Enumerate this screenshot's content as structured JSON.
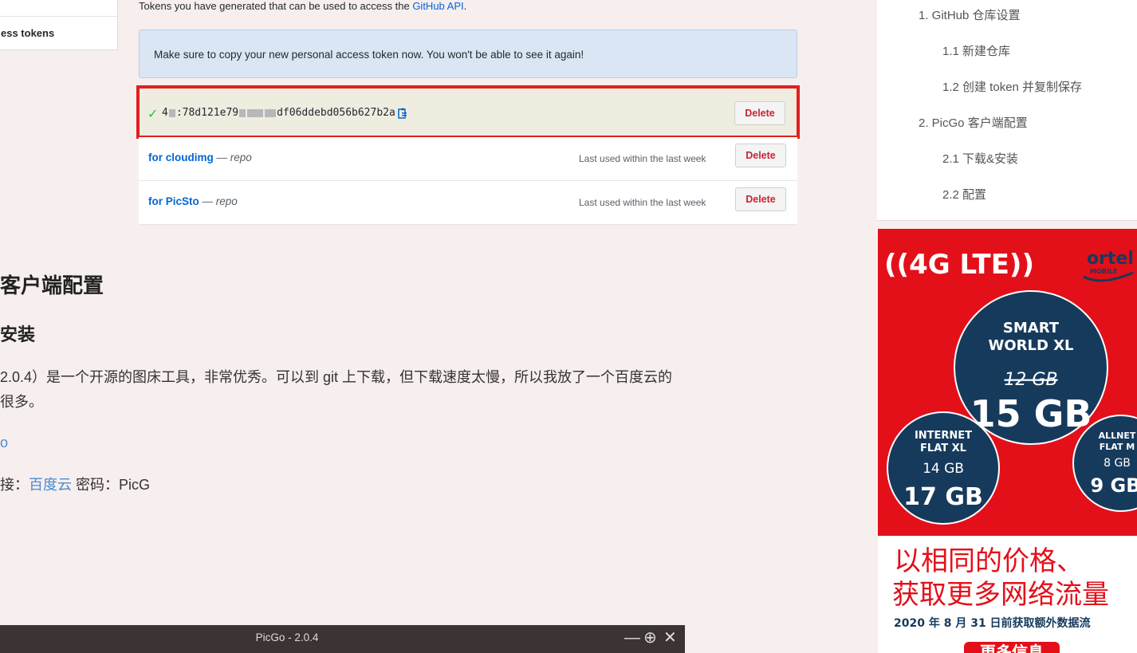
{
  "tokens_page": {
    "nav_item": "ess tokens",
    "description": "Tokens you have generated that can be used to access the",
    "description_link": "GitHub API",
    "description_end": ".",
    "flash_message": "Make sure to copy your new personal access token now. You won't be able to see it again!",
    "new_token": {
      "part1": "4",
      "part2": ":78d121e79",
      "part3": "df06ddebd056b627b2a",
      "delete_label": "Delete"
    },
    "rows": [
      {
        "name": "for cloudimg",
        "scope": "— repo",
        "last_used": "Last used within the last week",
        "delete_label": "Delete"
      },
      {
        "name": "for PicSto",
        "scope": "— repo",
        "last_used": "Last used within the last week",
        "delete_label": "Delete"
      }
    ]
  },
  "article": {
    "section_heading": "客户端配置",
    "sub_heading": "安装",
    "paragraph_line1": "2.0.4）是一个开源的图床工具，非常优秀。可以到 git 上下载，但下载速度太慢，所以我放了一个百度云的",
    "paragraph_line2": "很多。",
    "link_fragment": "o",
    "password_prefix": "接：",
    "password_link": "百度云",
    "password_suffix": " 密码：PicG"
  },
  "picgo_window": {
    "title": "PicGo - 2.0.4",
    "minimize": "—",
    "maximize": "⊕",
    "close": "✕"
  },
  "toc": {
    "items": [
      "1. GitHub 仓库设置",
      "1.1 新建仓库",
      "1.2 创建 token 并复制保存",
      "2. PicGo 客户端配置",
      "2.1 下载&安装",
      "2.2 配置"
    ]
  },
  "ad": {
    "badge": "((4G LTE))",
    "brand": "ortel",
    "brand_sub": "MOBILE",
    "main_plan": {
      "name_line1": "SMART",
      "name_line2": "WORLD XL",
      "old": "12 GB",
      "new": "15 GB"
    },
    "left_plan": {
      "name_line1": "INTERNET",
      "name_line2": "FLAT XL",
      "old": "14 GB",
      "new": "17 GB"
    },
    "right_plan": {
      "name_line1": "ALLNET",
      "name_line2": "FLAT M",
      "old": "8 GB",
      "new": "9 GB"
    },
    "headline1": "以相同的价格、",
    "headline2": "获取更多网络流量",
    "date_line": "2020 年 8 月 31 日前获取额外数据流",
    "cta": "更多信息"
  },
  "colors": {
    "accent_red": "#e02020",
    "link_blue": "#0366d6",
    "ad_red": "#e3101a",
    "ad_navy": "#163a5c"
  }
}
